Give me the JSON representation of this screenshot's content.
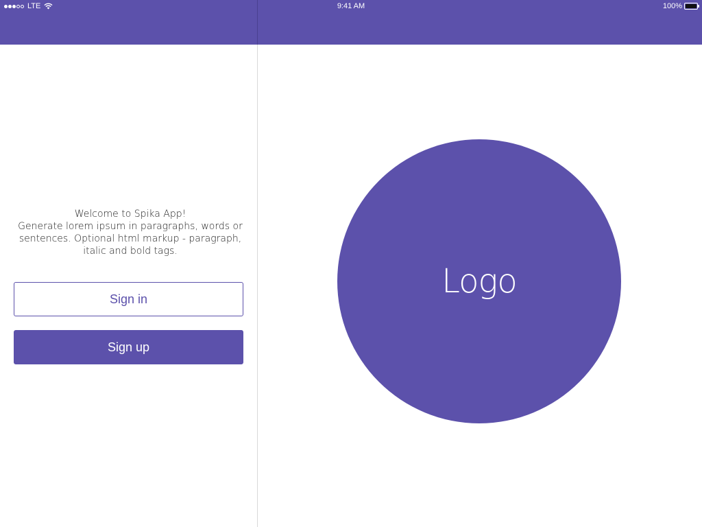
{
  "status_bar": {
    "carrier": "LTE",
    "signal_bars_filled": 3,
    "signal_bars_total": 5,
    "time": "9:41 AM",
    "battery": "100%"
  },
  "colors": {
    "accent": "#5c51ab",
    "background": "#ffffff",
    "text": "#222222"
  },
  "welcome": {
    "title": "Welcome to Spika App!",
    "body": "Generate lorem ipsum in paragraphs, words or sentences. Optional html markup - paragraph, italic and bold tags."
  },
  "buttons": {
    "sign_in": "Sign in",
    "sign_up": "Sign up"
  },
  "logo": {
    "text": "Logo"
  },
  "icons": [
    "signal-icon",
    "wifi-icon",
    "battery-icon"
  ]
}
